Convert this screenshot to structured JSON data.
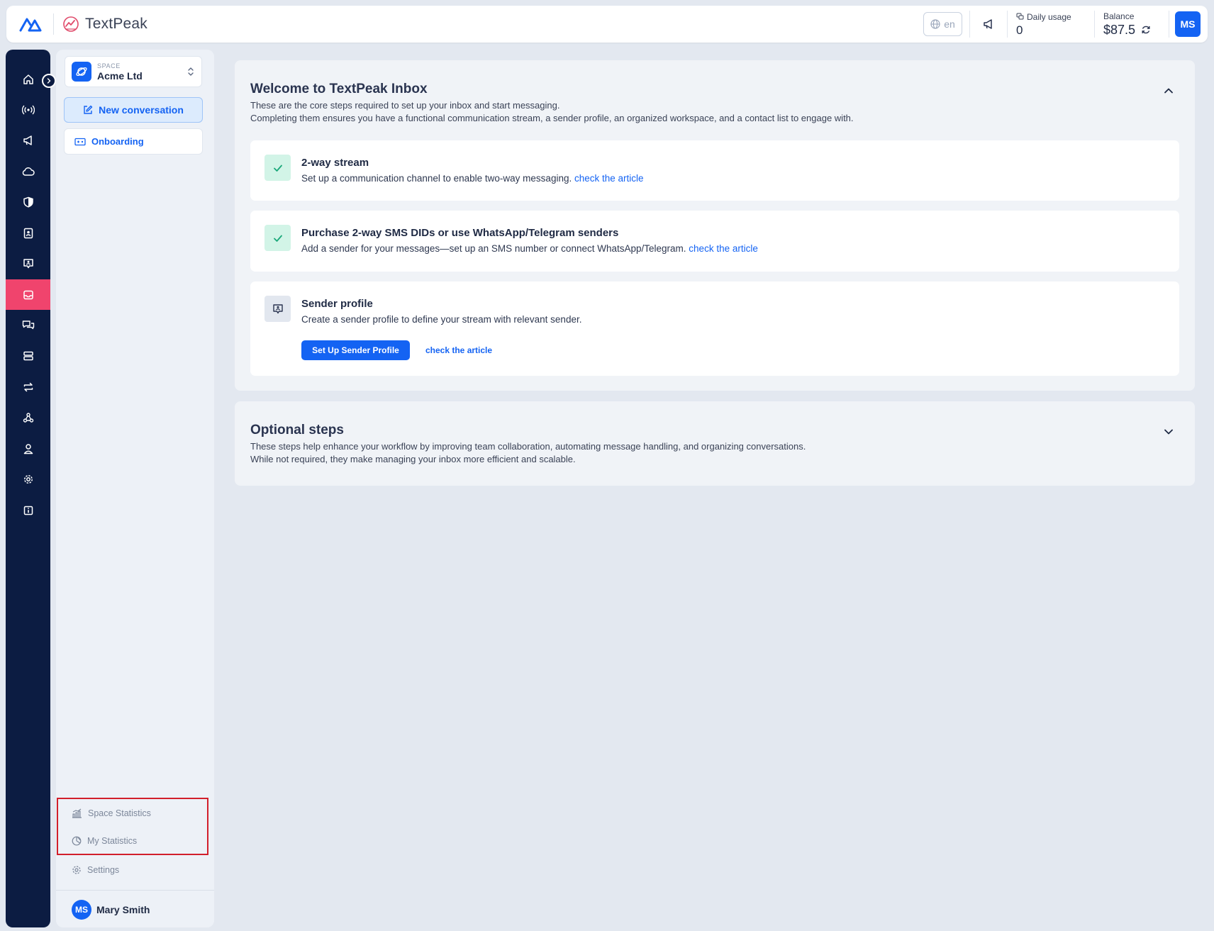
{
  "header": {
    "brand": "TextPeak",
    "language": "en",
    "daily_usage_label": "Daily usage",
    "daily_usage_value": "0",
    "balance_label": "Balance",
    "balance_value": "$87.5",
    "avatar_initials": "MS"
  },
  "rail": {
    "items": [
      {
        "name": "home",
        "icon": "home-icon"
      },
      {
        "name": "streams",
        "icon": "broadcast-icon"
      },
      {
        "name": "campaigns",
        "icon": "megaphone-icon"
      },
      {
        "name": "cloud",
        "icon": "cloud-icon"
      },
      {
        "name": "security",
        "icon": "shield-icon"
      },
      {
        "name": "contacts",
        "icon": "contact-card-icon"
      },
      {
        "name": "sender-profiles",
        "icon": "sender-profile-icon"
      },
      {
        "name": "inbox",
        "icon": "inbox-icon",
        "active": true
      },
      {
        "name": "chats",
        "icon": "chat-icon"
      },
      {
        "name": "servers",
        "icon": "server-icon"
      },
      {
        "name": "sync",
        "icon": "sync-arrows-icon"
      },
      {
        "name": "webhooks",
        "icon": "webhook-icon"
      },
      {
        "name": "users",
        "icon": "user-icon"
      },
      {
        "name": "settings",
        "icon": "gear-icon"
      },
      {
        "name": "info",
        "icon": "info-icon"
      }
    ]
  },
  "sidebar": {
    "space_label": "SPACE",
    "space_name": "Acme Ltd",
    "new_conversation": "New conversation",
    "onboarding": "Onboarding",
    "space_statistics": "Space Statistics",
    "my_statistics": "My Statistics",
    "settings": "Settings",
    "user_initials": "MS",
    "user_name": "Mary Smith"
  },
  "welcome": {
    "title": "Welcome to TextPeak Inbox",
    "desc1": "These are the core steps required to set up your inbox and start messaging.",
    "desc2": "Completing them ensures you have a functional communication stream, a sender profile, an organized workspace, and a contact list to engage with.",
    "steps": [
      {
        "title": "2-way stream",
        "desc": "Set up a communication channel to enable two-way messaging.",
        "link": "check the article",
        "status": "done"
      },
      {
        "title": "Purchase 2-way SMS DIDs or use WhatsApp/Telegram senders",
        "desc": "Add a sender for your messages—set up an SMS number or connect WhatsApp/Telegram.",
        "link": "check the article",
        "status": "done"
      },
      {
        "title": "Sender profile",
        "desc": "Create a sender profile to define your stream with relevant sender.",
        "button": "Set Up Sender Profile",
        "link": "check the article",
        "status": "todo"
      }
    ]
  },
  "optional": {
    "title": "Optional steps",
    "desc1": "These steps help enhance your workflow by improving team collaboration, automating message handling, and organizing conversations.",
    "desc2": "While not required, they make managing your inbox more efficient and scalable."
  },
  "colors": {
    "accent": "#1463f3",
    "rail_bg": "#0c1c42",
    "rail_active": "#f0446d",
    "highlight_box": "#d21f2b",
    "done_bg": "#d2f4e7",
    "done_check": "#1aa87a"
  }
}
